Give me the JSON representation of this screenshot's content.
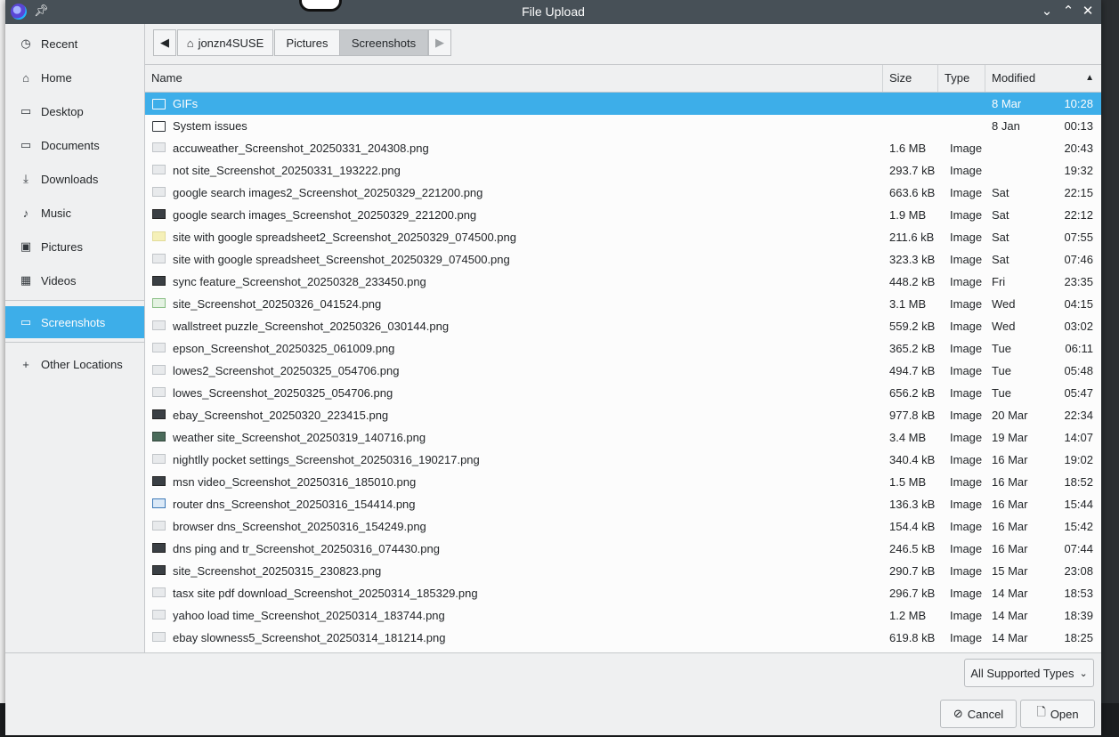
{
  "window": {
    "title": "File Upload"
  },
  "sidebar": {
    "items": [
      {
        "label": "Recent",
        "icon": "clock-icon"
      },
      {
        "label": "Home",
        "icon": "home-icon"
      },
      {
        "label": "Desktop",
        "icon": "folder-icon"
      },
      {
        "label": "Documents",
        "icon": "folder-icon"
      },
      {
        "label": "Downloads",
        "icon": "download-icon"
      },
      {
        "label": "Music",
        "icon": "music-icon"
      },
      {
        "label": "Pictures",
        "icon": "image-icon"
      },
      {
        "label": "Videos",
        "icon": "film-icon"
      },
      {
        "label": "Screenshots",
        "icon": "folder-icon",
        "active": true
      },
      {
        "label": "Other Locations",
        "icon": "plus-icon"
      }
    ]
  },
  "pathbar": {
    "crumbs": [
      "jonzn4SUSE",
      "Pictures",
      "Screenshots"
    ]
  },
  "columns": {
    "name": "Name",
    "size": "Size",
    "type": "Type",
    "modified": "Modified"
  },
  "files": [
    {
      "name": "GIFs",
      "size": "",
      "type": "",
      "day": "8 Mar",
      "time": "10:28",
      "kind": "folder",
      "selected": true
    },
    {
      "name": "System issues",
      "size": "",
      "type": "",
      "day": "8 Jan",
      "time": "00:13",
      "kind": "folder"
    },
    {
      "name": "accuweather_Screenshot_20250331_204308.png",
      "size": "1.6 MB",
      "type": "Image",
      "day": "",
      "time": "20:43",
      "kind": "thumb"
    },
    {
      "name": "not site_Screenshot_20250331_193222.png",
      "size": "293.7 kB",
      "type": "Image",
      "day": "",
      "time": "19:32",
      "kind": "thumb"
    },
    {
      "name": "google search images2_Screenshot_20250329_221200.png",
      "size": "663.6 kB",
      "type": "Image",
      "day": "Sat",
      "time": "22:15",
      "kind": "thumb"
    },
    {
      "name": "google search images_Screenshot_20250329_221200.png",
      "size": "1.9 MB",
      "type": "Image",
      "day": "Sat",
      "time": "22:12",
      "kind": "thumb-dark"
    },
    {
      "name": "site with google spreadsheet2_Screenshot_20250329_074500.png",
      "size": "211.6 kB",
      "type": "Image",
      "day": "Sat",
      "time": "07:55",
      "kind": "thumb-yellow"
    },
    {
      "name": "site with google spreadsheet_Screenshot_20250329_074500.png",
      "size": "323.3 kB",
      "type": "Image",
      "day": "Sat",
      "time": "07:46",
      "kind": "thumb"
    },
    {
      "name": "sync feature_Screenshot_20250328_233450.png",
      "size": "448.2 kB",
      "type": "Image",
      "day": "Fri",
      "time": "23:35",
      "kind": "thumb-dark"
    },
    {
      "name": "site_Screenshot_20250326_041524.png",
      "size": "3.1 MB",
      "type": "Image",
      "day": "Wed",
      "time": "04:15",
      "kind": "thumb-green"
    },
    {
      "name": "wallstreet puzzle_Screenshot_20250326_030144.png",
      "size": "559.2 kB",
      "type": "Image",
      "day": "Wed",
      "time": "03:02",
      "kind": "thumb"
    },
    {
      "name": "epson_Screenshot_20250325_061009.png",
      "size": "365.2 kB",
      "type": "Image",
      "day": "Tue",
      "time": "06:11",
      "kind": "thumb"
    },
    {
      "name": "lowes2_Screenshot_20250325_054706.png",
      "size": "494.7 kB",
      "type": "Image",
      "day": "Tue",
      "time": "05:48",
      "kind": "thumb"
    },
    {
      "name": "lowes_Screenshot_20250325_054706.png",
      "size": "656.2 kB",
      "type": "Image",
      "day": "Tue",
      "time": "05:47",
      "kind": "thumb"
    },
    {
      "name": "ebay_Screenshot_20250320_223415.png",
      "size": "977.8 kB",
      "type": "Image",
      "day": "20 Mar",
      "time": "22:34",
      "kind": "thumb-dark"
    },
    {
      "name": "weather site_Screenshot_20250319_140716.png",
      "size": "3.4 MB",
      "type": "Image",
      "day": "19 Mar",
      "time": "14:07",
      "kind": "thumb-photo"
    },
    {
      "name": "nightlly pocket settings_Screenshot_20250316_190217.png",
      "size": "340.4 kB",
      "type": "Image",
      "day": "16 Mar",
      "time": "19:02",
      "kind": "thumb"
    },
    {
      "name": "msn video_Screenshot_20250316_185010.png",
      "size": "1.5 MB",
      "type": "Image",
      "day": "16 Mar",
      "time": "18:52",
      "kind": "thumb-dark"
    },
    {
      "name": "router dns_Screenshot_20250316_154414.png",
      "size": "136.3 kB",
      "type": "Image",
      "day": "16 Mar",
      "time": "15:44",
      "kind": "thumb-blue"
    },
    {
      "name": "browser dns_Screenshot_20250316_154249.png",
      "size": "154.4 kB",
      "type": "Image",
      "day": "16 Mar",
      "time": "15:42",
      "kind": "thumb"
    },
    {
      "name": "dns ping and tr_Screenshot_20250316_074430.png",
      "size": "246.5 kB",
      "type": "Image",
      "day": "16 Mar",
      "time": "07:44",
      "kind": "thumb-dark"
    },
    {
      "name": "site_Screenshot_20250315_230823.png",
      "size": "290.7 kB",
      "type": "Image",
      "day": "15 Mar",
      "time": "23:08",
      "kind": "thumb-dark"
    },
    {
      "name": "tasx site pdf download_Screenshot_20250314_185329.png",
      "size": "296.7 kB",
      "type": "Image",
      "day": "14 Mar",
      "time": "18:53",
      "kind": "thumb"
    },
    {
      "name": "yahoo load time_Screenshot_20250314_183744.png",
      "size": "1.2 MB",
      "type": "Image",
      "day": "14 Mar",
      "time": "18:39",
      "kind": "thumb"
    },
    {
      "name": "ebay slowness5_Screenshot_20250314_181214.png",
      "size": "619.8 kB",
      "type": "Image",
      "day": "14 Mar",
      "time": "18:25",
      "kind": "thumb"
    }
  ],
  "footer": {
    "filter_label": "All Supported Types",
    "cancel_label": "Cancel",
    "open_label": "Open"
  },
  "colors": {
    "accent": "#3daee9",
    "titlebar": "#475057"
  }
}
